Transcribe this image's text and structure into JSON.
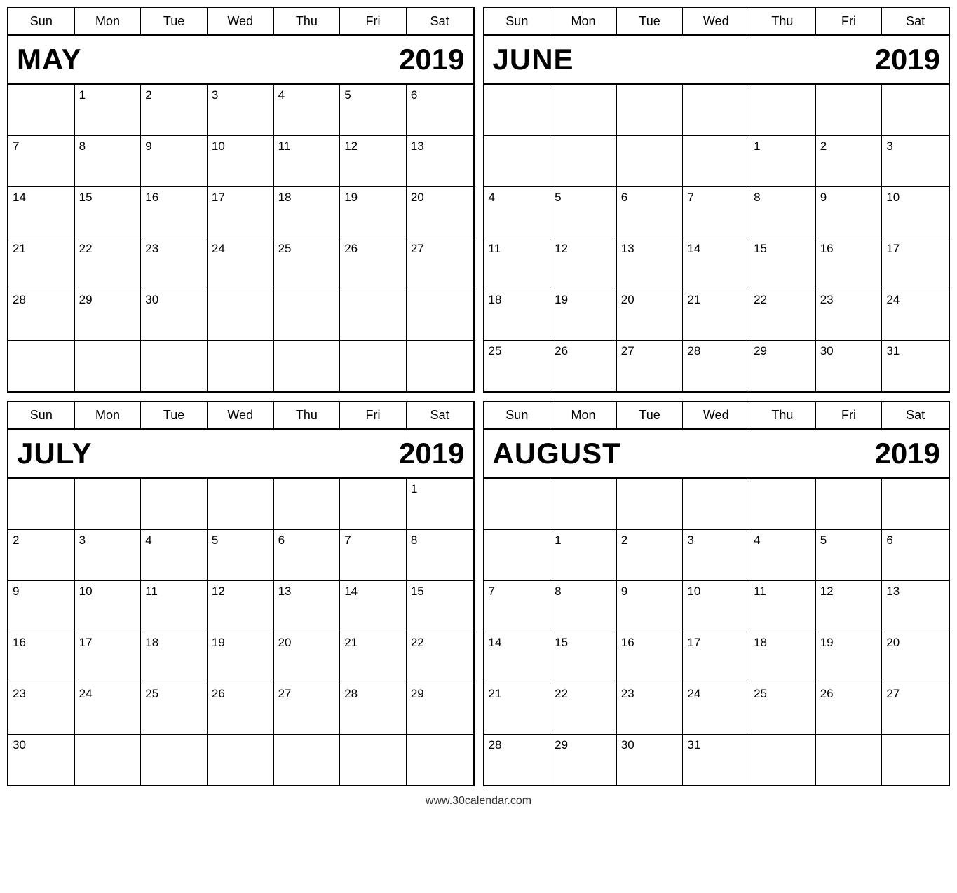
{
  "footer": "www.30calendar.com",
  "calendars": [
    {
      "id": "may-2019",
      "month": "MAY",
      "year": "2019",
      "days_header": [
        "Sun",
        "Mon",
        "Tue",
        "Wed",
        "Thu",
        "Fri",
        "Sat"
      ],
      "weeks": [
        [
          "",
          "1",
          "2",
          "3",
          "4",
          "5",
          "6"
        ],
        [
          "7",
          "8",
          "9",
          "10",
          "11",
          "12",
          "13"
        ],
        [
          "14",
          "15",
          "16",
          "17",
          "18",
          "19",
          "20"
        ],
        [
          "21",
          "22",
          "23",
          "24",
          "25",
          "26",
          "27"
        ],
        [
          "28",
          "29",
          "30",
          "",
          "",
          "",
          ""
        ],
        [
          "",
          "",
          "",
          "",
          "",
          "",
          ""
        ]
      ]
    },
    {
      "id": "june-2019",
      "month": "JUNE",
      "year": "2019",
      "days_header": [
        "Sun",
        "Mon",
        "Tue",
        "Wed",
        "Thu",
        "Fri",
        "Sat"
      ],
      "weeks": [
        [
          "",
          "",
          "",
          "",
          "",
          "",
          ""
        ],
        [
          "",
          "",
          "",
          "",
          "1",
          "2",
          "3"
        ],
        [
          "4",
          "5",
          "6",
          "7",
          "8",
          "9",
          "10"
        ],
        [
          "11",
          "12",
          "13",
          "14",
          "15",
          "16",
          "17"
        ],
        [
          "18",
          "19",
          "20",
          "21",
          "22",
          "23",
          "24"
        ],
        [
          "25",
          "26",
          "27",
          "28",
          "29",
          "30",
          "31"
        ]
      ]
    },
    {
      "id": "july-2019",
      "month": "JULY",
      "year": "2019",
      "days_header": [
        "Sun",
        "Mon",
        "Tue",
        "Wed",
        "Thu",
        "Fri",
        "Sat"
      ],
      "weeks": [
        [
          "",
          "",
          "",
          "",
          "",
          "",
          "1"
        ],
        [
          "2",
          "3",
          "4",
          "5",
          "6",
          "7",
          "8"
        ],
        [
          "9",
          "10",
          "11",
          "12",
          "13",
          "14",
          "15"
        ],
        [
          "16",
          "17",
          "18",
          "19",
          "20",
          "21",
          "22"
        ],
        [
          "23",
          "24",
          "25",
          "26",
          "27",
          "28",
          "29"
        ],
        [
          "30",
          "",
          "",
          "",
          "",
          "",
          ""
        ]
      ]
    },
    {
      "id": "august-2019",
      "month": "AUGUST",
      "year": "2019",
      "days_header": [
        "Sun",
        "Mon",
        "Tue",
        "Wed",
        "Thu",
        "Fri",
        "Sat"
      ],
      "weeks": [
        [
          "",
          "",
          "",
          "",
          "",
          "",
          ""
        ],
        [
          "",
          "1",
          "2",
          "3",
          "4",
          "5",
          "6"
        ],
        [
          "7",
          "8",
          "9",
          "10",
          "11",
          "12",
          "13"
        ],
        [
          "14",
          "15",
          "16",
          "17",
          "18",
          "19",
          "20"
        ],
        [
          "21",
          "22",
          "23",
          "24",
          "25",
          "26",
          "27"
        ],
        [
          "28",
          "29",
          "30",
          "31",
          "",
          "",
          ""
        ]
      ]
    }
  ]
}
